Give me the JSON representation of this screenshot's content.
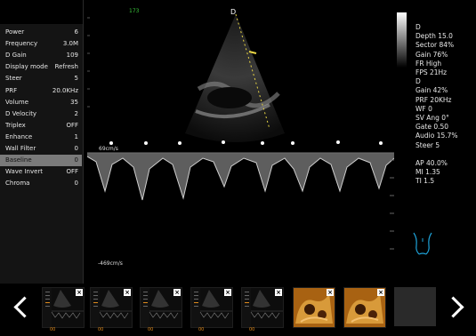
{
  "top_marker": "173",
  "probe_marker": "D",
  "left_params": [
    {
      "label": "Power",
      "value": "6"
    },
    {
      "label": "Frequency",
      "value": "3.0M"
    },
    {
      "label": "D Gain",
      "value": "109"
    },
    {
      "label": "Display mode",
      "value": "Refresh"
    },
    {
      "label": "Steer",
      "value": "5"
    },
    {
      "label": "PRF",
      "value": "20.0KHz"
    },
    {
      "label": "Volume",
      "value": "35"
    },
    {
      "label": "D Velocity",
      "value": "2"
    },
    {
      "label": "Triplex",
      "value": "OFF"
    },
    {
      "label": "Enhance",
      "value": "1"
    },
    {
      "label": "Wall Filter",
      "value": "0"
    },
    {
      "label": "Baseline",
      "value": "0"
    },
    {
      "label": "Wave Invert",
      "value": "OFF"
    },
    {
      "label": "Chroma",
      "value": "0"
    }
  ],
  "selected_param": "Baseline",
  "right_info": [
    "D",
    "Depth 15.0",
    "Sector 84%",
    "Gain 76%",
    "FR High",
    "FPS 21Hz",
    "D",
    "Gain 42%",
    "PRF 20KHz",
    "WF 0",
    "SV Ang 0°",
    "Gate 0.50",
    "Audio 15.7%",
    "Steer 5",
    "",
    "AP 40.0%",
    "MI 1.35",
    "TI 1.5"
  ],
  "velocity_top": "69cm/s",
  "velocity_bottom": "-469cm/s",
  "thumbnails": [
    {
      "type": "doppler",
      "tag": "00"
    },
    {
      "type": "doppler",
      "tag": "00"
    },
    {
      "type": "doppler",
      "tag": "00"
    },
    {
      "type": "doppler",
      "tag": "00"
    },
    {
      "type": "doppler",
      "tag": "00"
    },
    {
      "type": "render3d",
      "tag": ""
    },
    {
      "type": "render3d",
      "tag": ""
    }
  ],
  "colors": {
    "accent_green": "#39c43a",
    "tag_orange": "#e08a1c",
    "selected_bg": "#7a7a7a",
    "body_marker": "#1ea3d9"
  },
  "icons": {
    "prev": "chevron-left-icon",
    "next": "chevron-right-icon",
    "close": "close-icon",
    "body": "body-marker-icon"
  }
}
